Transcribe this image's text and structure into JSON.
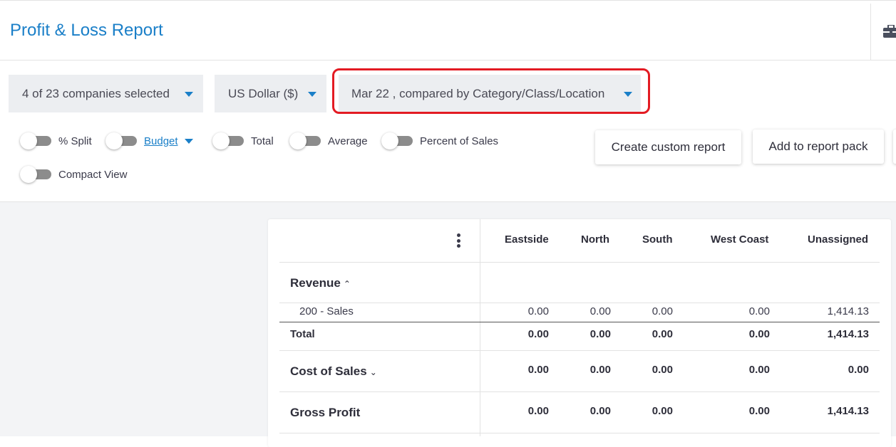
{
  "header": {
    "title": "Profit & Loss Report",
    "right_icon": "briefcase-icon"
  },
  "filters": {
    "companies": "4 of 23 companies selected",
    "currency": "US Dollar ($)",
    "period": "Mar 22 , compared by Category/Class/Location"
  },
  "toggles": {
    "split": "% Split",
    "budget": "Budget",
    "total": "Total",
    "average": "Average",
    "percent_of_sales": "Percent of Sales",
    "compact_view": "Compact View"
  },
  "buttons": {
    "create_custom": "Create custom report",
    "add_to_pack": "Add to report pack"
  },
  "table": {
    "columns": [
      "Eastside",
      "North",
      "South",
      "West Coast",
      "Unassigned"
    ],
    "revenue_label": "Revenue",
    "rows": {
      "sales": {
        "label": "200 - Sales",
        "values": [
          "0.00",
          "0.00",
          "0.00",
          "0.00",
          "1,414.13"
        ]
      },
      "total": {
        "label": "Total",
        "values": [
          "0.00",
          "0.00",
          "0.00",
          "0.00",
          "1,414.13"
        ]
      },
      "cost_of_sales": {
        "label": "Cost of Sales",
        "values": [
          "0.00",
          "0.00",
          "0.00",
          "0.00",
          "0.00"
        ]
      },
      "gross_profit": {
        "label": "Gross Profit",
        "values": [
          "0.00",
          "0.00",
          "0.00",
          "0.00",
          "1,414.13"
        ]
      }
    }
  },
  "colors": {
    "accent": "#1a7fc8",
    "highlight": "#e31b23",
    "dropdown_bg": "#eceef1"
  }
}
